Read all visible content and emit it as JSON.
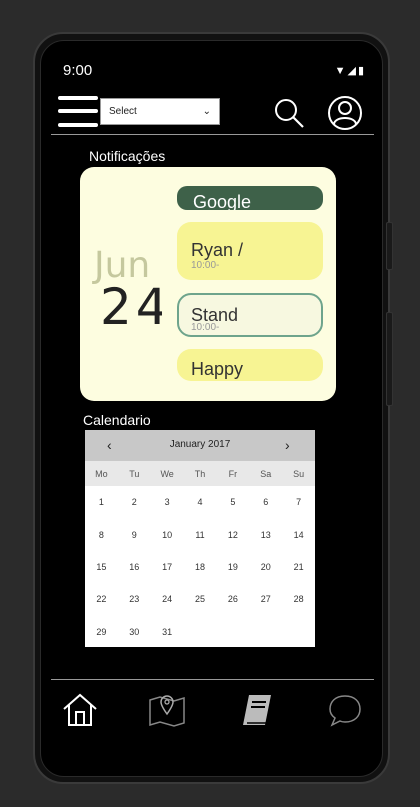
{
  "status_bar": {
    "time": "9:00",
    "icons": "▼◢▮"
  },
  "header": {
    "select_value": "Select",
    "select_caret": "⌄"
  },
  "notifications": {
    "title": "Notificações",
    "month": "Jun",
    "day": "24",
    "events": [
      {
        "title": "Google",
        "time": ""
      },
      {
        "title": "Ryan /",
        "time": "10:00-"
      },
      {
        "title": "Stand",
        "time": "10:00-"
      },
      {
        "title": "Happy",
        "time": ""
      }
    ]
  },
  "calendar": {
    "title": "Calendario",
    "month_label": "January 2017",
    "prev": "‹",
    "next": "›",
    "weekdays": [
      "Mo",
      "Tu",
      "We",
      "Th",
      "Fr",
      "Sa",
      "Su"
    ],
    "days": [
      "1",
      "2",
      "3",
      "4",
      "5",
      "6",
      "7",
      "8",
      "9",
      "10",
      "11",
      "12",
      "13",
      "14",
      "15",
      "16",
      "17",
      "18",
      "19",
      "20",
      "21",
      "22",
      "23",
      "24",
      "25",
      "26",
      "27",
      "28",
      "29",
      "30",
      "31"
    ]
  },
  "bottom_nav": [
    "home-icon",
    "map-icon",
    "book-icon",
    "chat-icon"
  ],
  "colors": {
    "card_bg": "#fdfde0",
    "green_event": "#3e6149",
    "yellow_event": "#f7f493",
    "outline_event": "#6ea48c"
  }
}
